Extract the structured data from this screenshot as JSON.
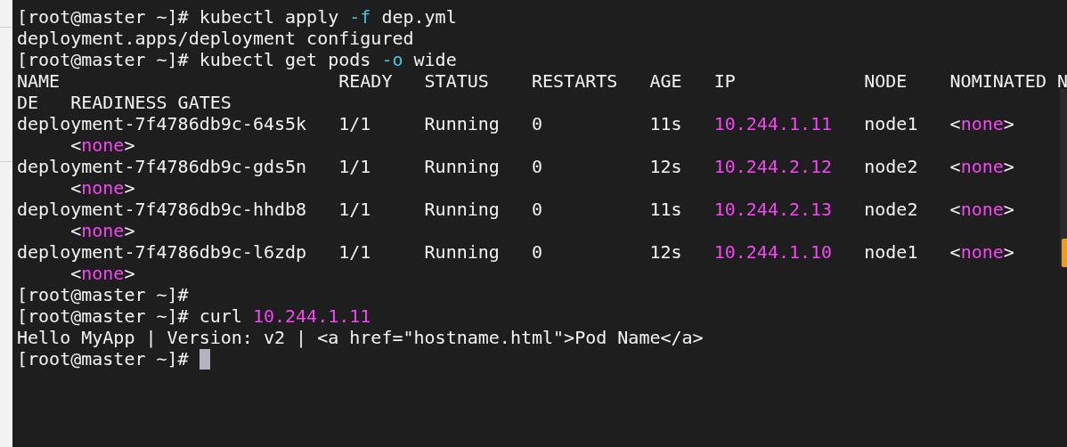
{
  "terminal": {
    "lines": [
      {
        "segments": [
          {
            "text": "[root@master ~]# kubectl apply ",
            "kind": "plain"
          },
          {
            "text": "-f",
            "kind": "option"
          },
          {
            "text": " dep.yml",
            "kind": "plain"
          }
        ]
      },
      {
        "segments": [
          {
            "text": "deployment.apps/deployment configured",
            "kind": "plain"
          }
        ]
      },
      {
        "segments": [
          {
            "text": "[root@master ~]# kubectl get pods ",
            "kind": "plain"
          },
          {
            "text": "-o",
            "kind": "option"
          },
          {
            "text": " wide",
            "kind": "plain"
          }
        ]
      },
      {
        "segments": [
          {
            "text": "NAME                          READY   STATUS    RESTARTS   AGE   IP            NODE    NOMINATED N",
            "kind": "plain"
          }
        ]
      },
      {
        "segments": [
          {
            "text": "DE   READINESS GATES",
            "kind": "plain"
          }
        ]
      },
      {
        "segments": [
          {
            "text": "deployment-7f4786db9c-64s5k   1/1     Running   0          11s   ",
            "kind": "plain"
          },
          {
            "text": "10.244.1.11",
            "kind": "value"
          },
          {
            "text": "   node1   <",
            "kind": "plain"
          },
          {
            "text": "none",
            "kind": "value"
          },
          {
            "text": ">",
            "kind": "plain"
          }
        ]
      },
      {
        "segments": [
          {
            "text": "     <",
            "kind": "plain"
          },
          {
            "text": "none",
            "kind": "value"
          },
          {
            "text": ">",
            "kind": "plain"
          }
        ]
      },
      {
        "segments": [
          {
            "text": "deployment-7f4786db9c-gds5n   1/1     Running   0          12s   ",
            "kind": "plain"
          },
          {
            "text": "10.244.2.12",
            "kind": "value"
          },
          {
            "text": "   node2   <",
            "kind": "plain"
          },
          {
            "text": "none",
            "kind": "value"
          },
          {
            "text": ">",
            "kind": "plain"
          }
        ]
      },
      {
        "segments": [
          {
            "text": "     <",
            "kind": "plain"
          },
          {
            "text": "none",
            "kind": "value"
          },
          {
            "text": ">",
            "kind": "plain"
          }
        ]
      },
      {
        "segments": [
          {
            "text": "deployment-7f4786db9c-hhdb8   1/1     Running   0          11s   ",
            "kind": "plain"
          },
          {
            "text": "10.244.2.13",
            "kind": "value"
          },
          {
            "text": "   node2   <",
            "kind": "plain"
          },
          {
            "text": "none",
            "kind": "value"
          },
          {
            "text": ">",
            "kind": "plain"
          }
        ]
      },
      {
        "segments": [
          {
            "text": "     <",
            "kind": "plain"
          },
          {
            "text": "none",
            "kind": "value"
          },
          {
            "text": ">",
            "kind": "plain"
          }
        ]
      },
      {
        "segments": [
          {
            "text": "deployment-7f4786db9c-l6zdp   1/1     Running   0          12s   ",
            "kind": "plain"
          },
          {
            "text": "10.244.1.10",
            "kind": "value"
          },
          {
            "text": "   node1   <",
            "kind": "plain"
          },
          {
            "text": "none",
            "kind": "value"
          },
          {
            "text": ">",
            "kind": "plain"
          }
        ]
      },
      {
        "segments": [
          {
            "text": "     <",
            "kind": "plain"
          },
          {
            "text": "none",
            "kind": "value"
          },
          {
            "text": ">",
            "kind": "plain"
          }
        ]
      },
      {
        "segments": [
          {
            "text": "[root@master ~]#",
            "kind": "plain"
          }
        ]
      },
      {
        "segments": [
          {
            "text": "[root@master ~]# curl ",
            "kind": "plain"
          },
          {
            "text": "10.244.1.11",
            "kind": "value"
          }
        ]
      },
      {
        "segments": [
          {
            "text": "Hello MyApp | Version: v2 | <a href=\"hostname.html\">Pod Name</a>",
            "kind": "plain"
          }
        ]
      },
      {
        "segments": [
          {
            "text": "[root@master ~]# ",
            "kind": "plain"
          }
        ],
        "cursor": true
      }
    ]
  }
}
